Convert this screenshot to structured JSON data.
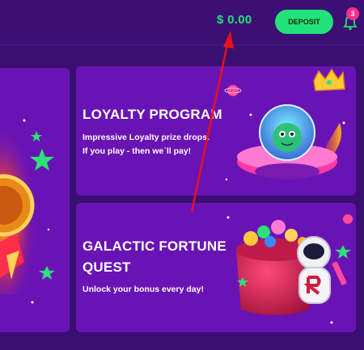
{
  "header": {
    "balance": "$ 0.00",
    "deposit_label": "DEPOSIT",
    "notifications_count": "3"
  },
  "promos": [
    {
      "title": "LOYALTY PROGRAM",
      "description_line1": "Impressive Loyalty prize drops.",
      "description_line2": "If you play - then we`ll pay!"
    },
    {
      "title_line1": "GALACTIC FORTUNE",
      "title_line2": "QUEST",
      "description": "Unlock your bonus every day!"
    }
  ],
  "colors": {
    "background": "#3a0f72",
    "card": "#6a13b5",
    "accent_green": "#22e27a",
    "badge_pink": "#ff2e8a",
    "annotation_arrow": "#e8101c"
  }
}
